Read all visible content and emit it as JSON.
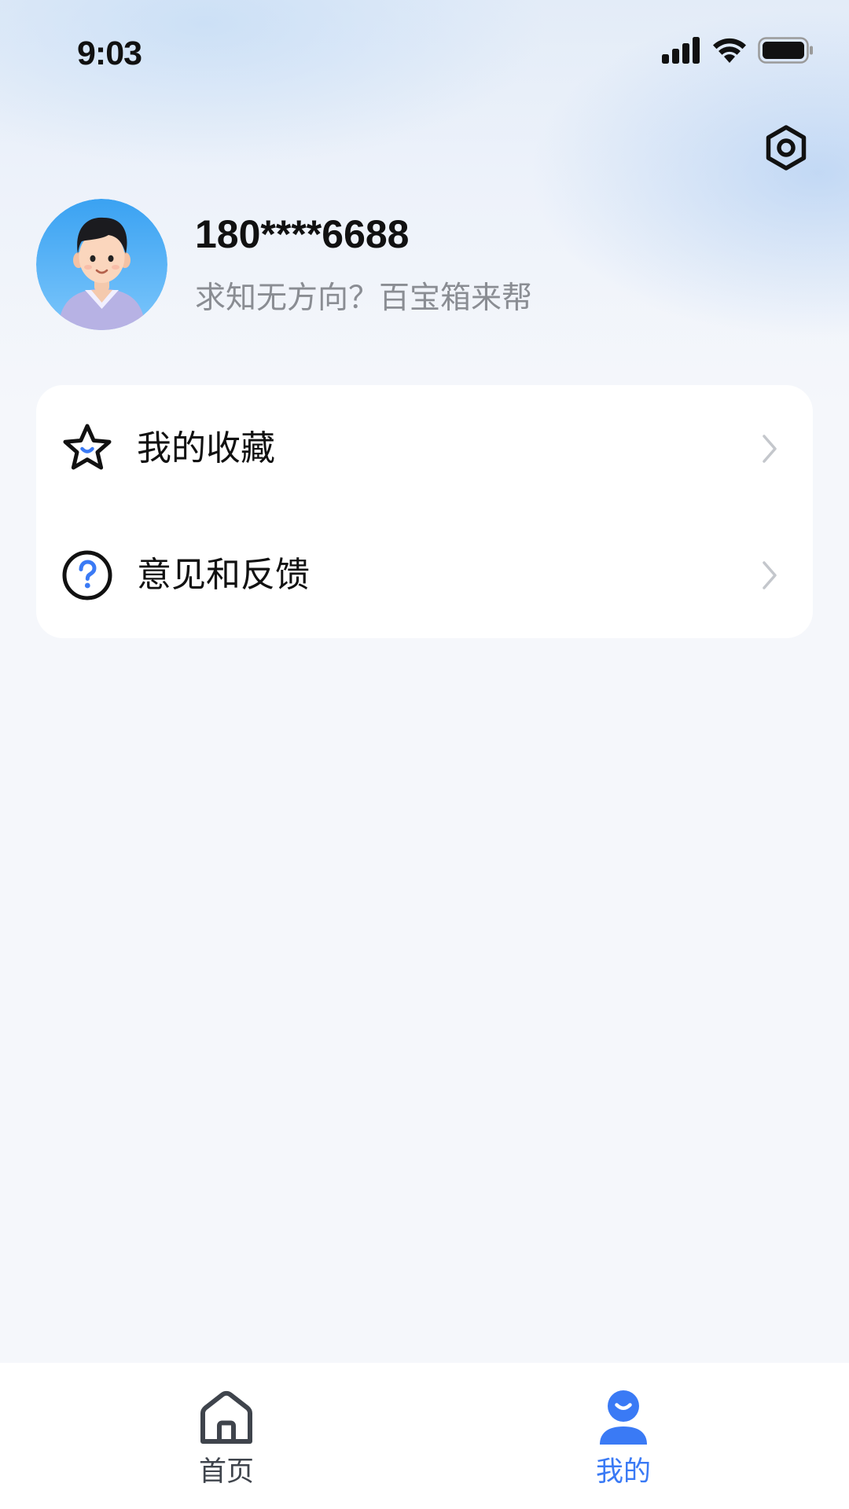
{
  "status_bar": {
    "time": "9:03",
    "icons": [
      "signal-icon",
      "wifi-icon",
      "battery-icon"
    ]
  },
  "header": {
    "settings_icon": "settings-icon"
  },
  "profile": {
    "username": "180****6688",
    "tagline": "求知无方向？百宝箱来帮",
    "avatar_icon": "avatar"
  },
  "menu": {
    "items": [
      {
        "label": "我的收藏",
        "icon": "star-icon"
      },
      {
        "label": "意见和反馈",
        "icon": "help-icon"
      }
    ]
  },
  "tab_bar": {
    "tabs": [
      {
        "label": "首页",
        "icon": "home-icon",
        "active": false
      },
      {
        "label": "我的",
        "icon": "user-icon",
        "active": true
      }
    ]
  },
  "colors": {
    "accent": "#3a7af5",
    "text_primary": "#111111",
    "text_secondary": "#8a8d93",
    "background": "#f5f7fb",
    "card": "#ffffff"
  }
}
